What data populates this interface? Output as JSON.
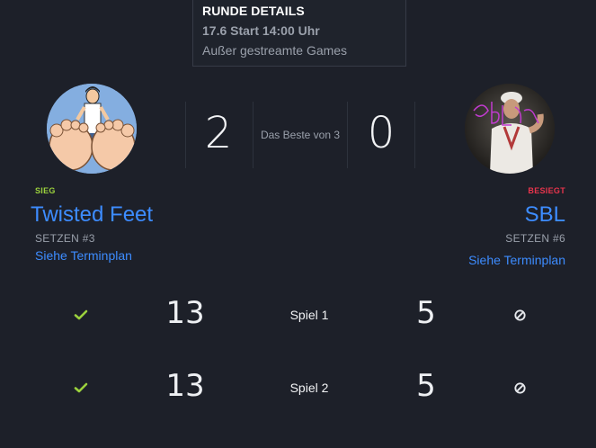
{
  "round_details": {
    "title": "RUNDE DETAILS",
    "datetime": "17.6 Start 14:00 Uhr",
    "subtitle": "Außer gestreamte Games"
  },
  "match": {
    "score_left": "2",
    "score_right": "0",
    "best_of": "Das Beste von 3"
  },
  "team_left": {
    "result": "SIEG",
    "name": "Twisted Feet",
    "seed": "SETZEN #3",
    "schedule_link": "Siehe Terminplan",
    "avatar_icon": "cartoon-feet-avatar"
  },
  "team_right": {
    "result": "BESIEGT",
    "name": "SBL",
    "seed": "SETZEN #6",
    "schedule_link": "Siehe Terminplan",
    "avatar_icon": "photo-avatar"
  },
  "games": [
    {
      "label": "Spiel 1",
      "score_left": "13",
      "score_right": "5",
      "left_icon": "check-icon",
      "right_icon": "no-entry-icon"
    },
    {
      "label": "Spiel 2",
      "score_left": "13",
      "score_right": "5",
      "left_icon": "check-icon",
      "right_icon": "no-entry-icon"
    }
  ],
  "colors": {
    "background": "#1d2029",
    "accent_link": "#3d8cff",
    "win": "#9bd13d",
    "loss": "#e8344c",
    "muted": "#9aa0ab"
  }
}
